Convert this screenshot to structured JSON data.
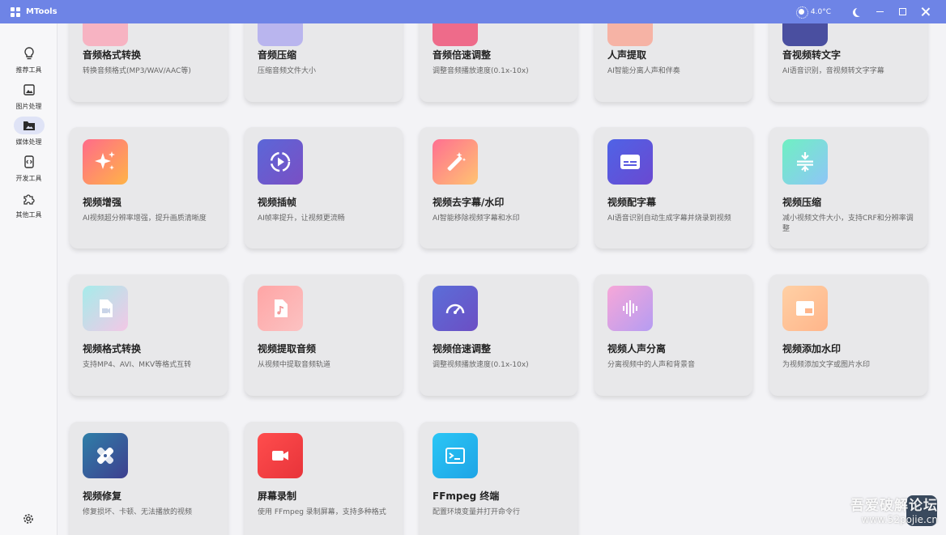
{
  "titlebar": {
    "title": "MTools",
    "temperature": "4.0°C"
  },
  "sidebar": {
    "items": [
      {
        "label": "推荐工具",
        "icon": "lightbulb-icon"
      },
      {
        "label": "图片处理",
        "icon": "image-icon"
      },
      {
        "label": "媒体处理",
        "icon": "media-folder-icon"
      },
      {
        "label": "开发工具",
        "icon": "dev-tools-icon"
      },
      {
        "label": "其他工具",
        "icon": "puzzle-icon"
      }
    ],
    "active_index": 2
  },
  "cards": [
    {
      "name": "音频格式转换",
      "desc": "转换音频格式(MP3/WAV/AAC等)",
      "color": "#f7b3c2"
    },
    {
      "name": "音频压缩",
      "desc": "压缩音频文件大小",
      "color": "#b9b5ee"
    },
    {
      "name": "音频倍速调整",
      "desc": "调整音频播放速度(0.1x-10x)",
      "color": "#ee6b8a"
    },
    {
      "name": "人声提取",
      "desc": "AI智能分离人声和伴奏",
      "color": "#f6b3a5"
    },
    {
      "name": "音视频转文字",
      "desc": "AI语音识别，音视频转文字字幕",
      "color": "#4a4fa0"
    },
    {
      "name": "视频增强",
      "desc": "AI视频超分辨率增强，提升画质清晰度",
      "icon": "sparkle-icon"
    },
    {
      "name": "视频插帧",
      "desc": "AI帧率提升，让视频更流畅",
      "icon": "play-circle-icon"
    },
    {
      "name": "视频去字幕/水印",
      "desc": "AI智能移除视频字幕和水印",
      "icon": "magic-wand-icon"
    },
    {
      "name": "视频配字幕",
      "desc": "AI语音识别自动生成字幕并烧录到视频",
      "icon": "subtitles-icon"
    },
    {
      "name": "视频压缩",
      "desc": "减小视频文件大小，支持CRF和分辨率调整",
      "icon": "compress-icon"
    },
    {
      "name": "视频格式转换",
      "desc": "支持MP4、AVI、MKV等格式互转",
      "icon": "video-file-icon"
    },
    {
      "name": "视频提取音频",
      "desc": "从视频中提取音频轨道",
      "icon": "audio-file-icon"
    },
    {
      "name": "视频倍速调整",
      "desc": "调整视频播放速度(0.1x-10x)",
      "icon": "speedometer-icon"
    },
    {
      "name": "视频人声分离",
      "desc": "分离视频中的人声和背景音",
      "icon": "waveform-icon"
    },
    {
      "name": "视频添加水印",
      "desc": "为视频添加文字或图片水印",
      "icon": "watermark-icon"
    },
    {
      "name": "视频修复",
      "desc": "修复损坏、卡顿、无法播放的视频",
      "icon": "repair-icon"
    },
    {
      "name": "屏幕录制",
      "desc": "使用 FFmpeg 录制屏幕，支持多种格式",
      "icon": "camera-icon"
    },
    {
      "name": "FFmpeg 终端",
      "desc": "配置环境变量并打开命令行",
      "icon": "terminal-icon"
    }
  ],
  "watermark": {
    "line1": "吾爱破解论坛",
    "line2": "www.52pojie.cn"
  }
}
